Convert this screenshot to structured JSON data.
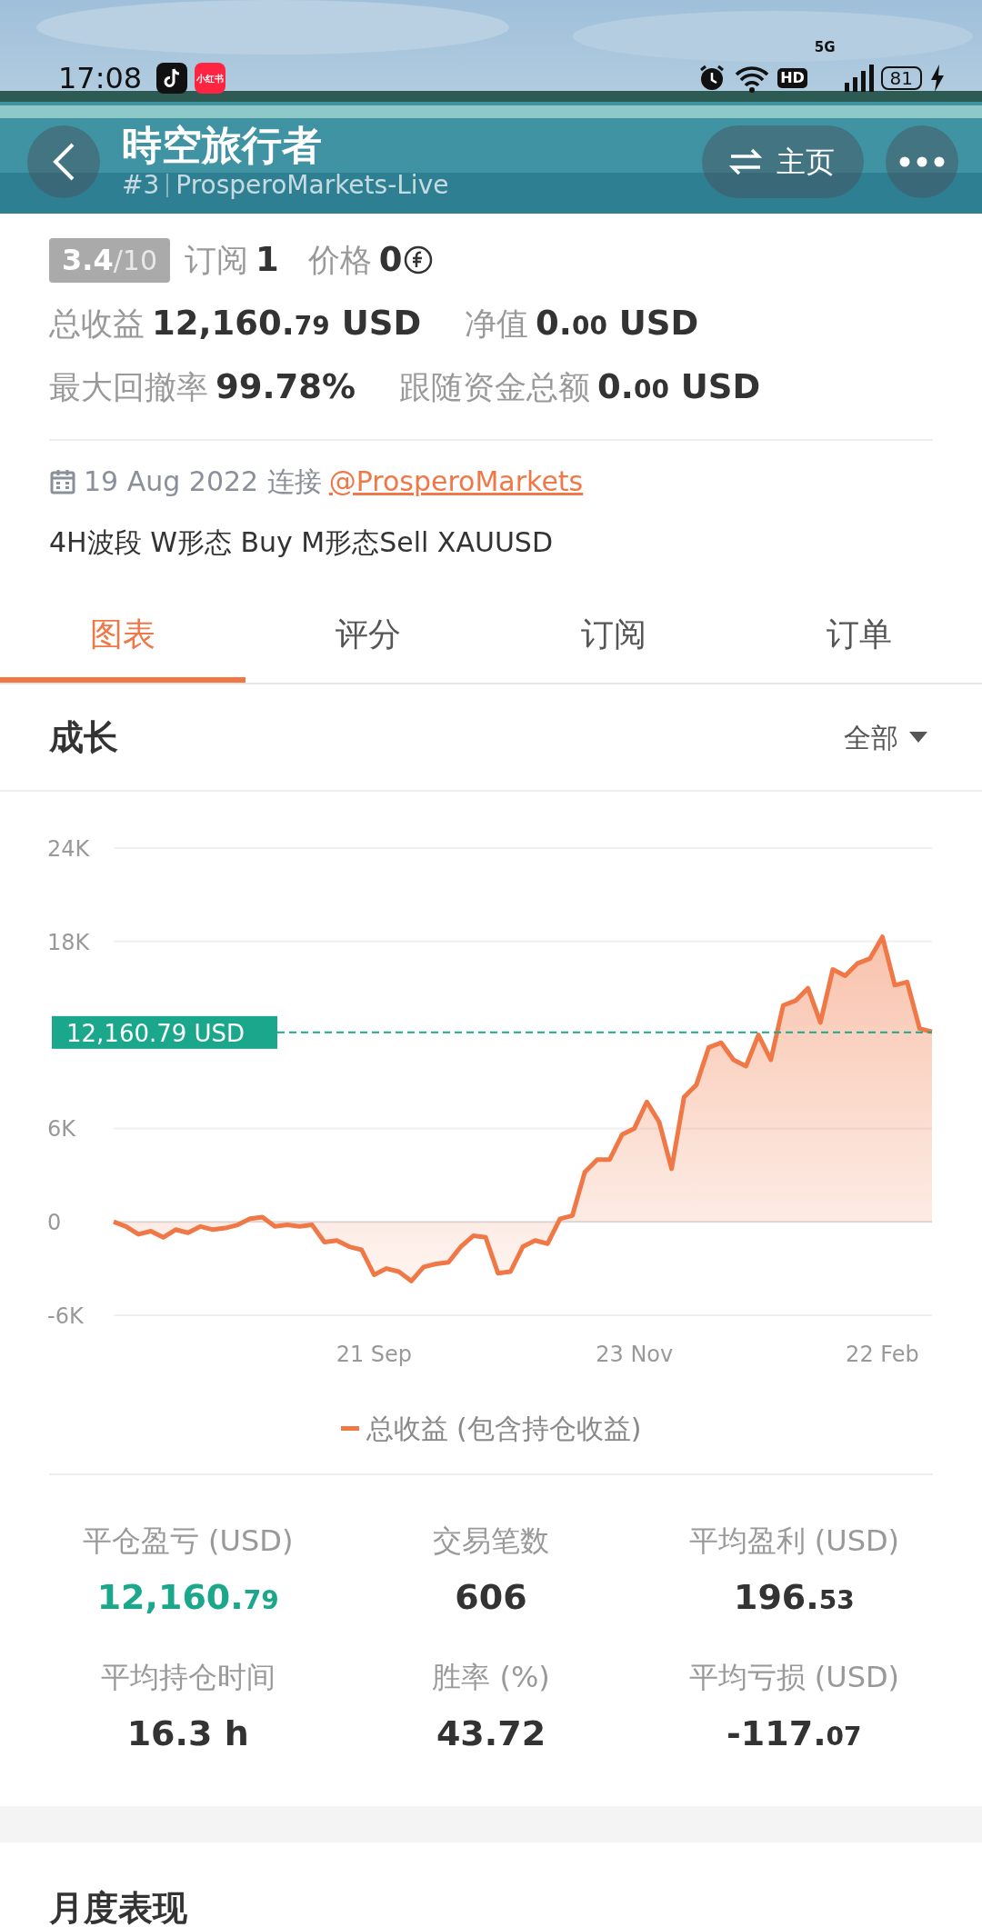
{
  "status_bar": {
    "time": "17:08",
    "app_badge": "小红书",
    "hd": "HD",
    "network": "5G",
    "battery": "81"
  },
  "header": {
    "title": "時空旅行者",
    "rank": "#3",
    "server": "ProsperoMarkets-Live",
    "home_button": "主页"
  },
  "summary": {
    "rating": "3.4",
    "rating_max": "/10",
    "subscribe_label": "订阅",
    "subscribe_value": "1",
    "price_label": "价格",
    "price_value": "0"
  },
  "metric_rows": [
    [
      {
        "label": "总收益",
        "value": "12,160.",
        "fraction": "79",
        "unit": "USD"
      },
      {
        "label": "净值",
        "value": "0.",
        "fraction": "00",
        "unit": "USD"
      }
    ],
    [
      {
        "label": "最大回撤率",
        "value": "99.78%"
      },
      {
        "label": "跟随资金总额",
        "value": "0.",
        "fraction": "00",
        "unit": "USD"
      }
    ]
  ],
  "connection": {
    "date": "19 Aug 2022",
    "verb": "连接",
    "broker": "@ProsperoMarkets"
  },
  "description": "4H波段 W形态 Buy M形态Sell XAUUSD",
  "tabs": [
    {
      "label": "图表",
      "selected": true
    },
    {
      "label": "评分",
      "selected": false
    },
    {
      "label": "订阅",
      "selected": false
    },
    {
      "label": "订单",
      "selected": false
    }
  ],
  "growth": {
    "title": "成长",
    "filter": "全部",
    "chart_data": {
      "type": "area",
      "categories": [
        null,
        null,
        null,
        null,
        null,
        null,
        null,
        null,
        null,
        null,
        null,
        null,
        null,
        null,
        null,
        null,
        null,
        null,
        null,
        null,
        null,
        "21 Sep",
        null,
        null,
        null,
        null,
        null,
        null,
        null,
        null,
        null,
        null,
        null,
        null,
        null,
        null,
        null,
        null,
        null,
        null,
        null,
        null,
        "23 Nov",
        null,
        null,
        null,
        null,
        null,
        null,
        null,
        null,
        null,
        null,
        null,
        null,
        null,
        null,
        null,
        null,
        null,
        null,
        null,
        "22 Feb",
        null,
        null,
        null,
        null
      ],
      "series": [
        {
          "name": "总收益 (包含持仓收益)",
          "color": "#f07846",
          "values": [
            0,
            -300,
            -800,
            -600,
            -1000,
            -500,
            -700,
            -300,
            -500,
            -400,
            -200,
            200,
            300,
            -300,
            -200,
            -300,
            -200,
            -1300,
            -1200,
            -1600,
            -1800,
            -3400,
            -3000,
            -3200,
            -3800,
            -2900,
            -2700,
            -2600,
            -1600,
            -900,
            -1000,
            -3300,
            -3200,
            -1600,
            -1200,
            -1400,
            200,
            400,
            3200,
            4000,
            4000,
            5600,
            6000,
            7700,
            6400,
            3400,
            8000,
            8800,
            11200,
            11500,
            10400,
            10000,
            12000,
            10400,
            13900,
            14200,
            15000,
            12800,
            16200,
            15800,
            16600,
            16900,
            18300,
            15200,
            15400,
            12400,
            12200
          ]
        }
      ],
      "ylim": [
        -6000,
        24000
      ],
      "yticks": [
        {
          "value": -6000,
          "label": "-6K"
        },
        {
          "value": 0,
          "label": "0"
        },
        {
          "value": 6000,
          "label": "6K"
        },
        {
          "value": 18000,
          "label": "18K"
        },
        {
          "value": 24000,
          "label": "24K"
        }
      ],
      "ref_lines": [
        {
          "axis": "y",
          "value": 12160.79,
          "label": "12,160.79 USD"
        }
      ]
    }
  },
  "stats": [
    {
      "label": "平仓盈亏 (USD)",
      "value": "12,160.",
      "fraction": "79",
      "kind": "gain"
    },
    {
      "label": "交易笔数",
      "value": "606",
      "kind": "plain"
    },
    {
      "label": "平均盈利 (USD)",
      "value": "196.",
      "fraction": "53",
      "kind": "plain"
    },
    {
      "label": "平均持仓时间",
      "value": "16.3 h",
      "kind": "plain"
    },
    {
      "label": "胜率 (%)",
      "value": "43.72",
      "kind": "plain"
    },
    {
      "label": "平均亏损 (USD)",
      "value": "-117.",
      "fraction": "07",
      "kind": "plain"
    }
  ],
  "monthly": {
    "title": "月度表现"
  }
}
